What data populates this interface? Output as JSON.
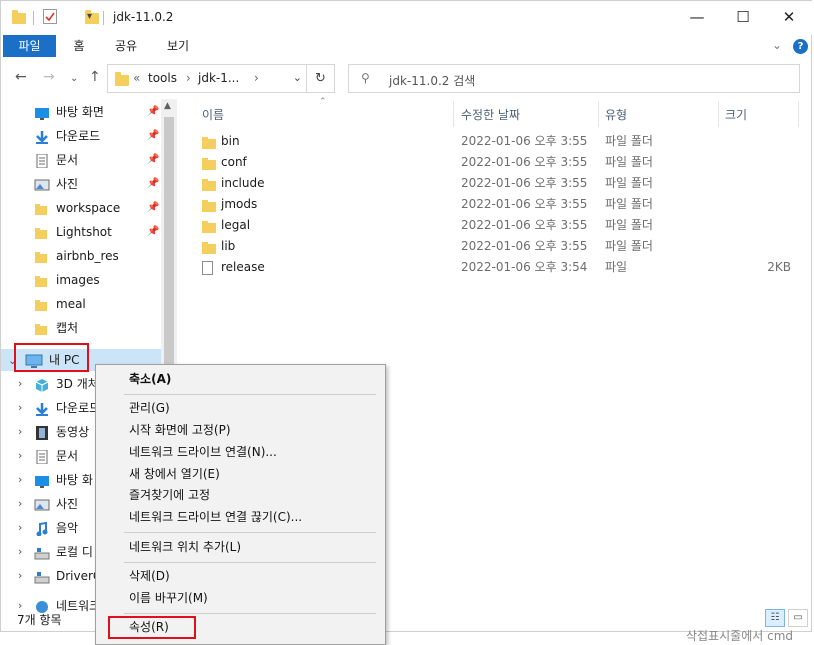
{
  "window": {
    "title": "jdk-11.0.2"
  },
  "ribbon": {
    "tabs": [
      "파일",
      "홈",
      "공유",
      "보기"
    ],
    "active_tab": "파일",
    "help": "?"
  },
  "address": {
    "crumbs": [
      "«",
      "tools",
      "›",
      "jdk-1...",
      "›"
    ],
    "dropdown": "⌄",
    "refresh": "↻"
  },
  "search": {
    "placeholder": "jdk-11.0.2 검색"
  },
  "nav_pane": {
    "quick_access": [
      {
        "label": "바탕 화면",
        "icon": "desktop-icon",
        "pinned": true
      },
      {
        "label": "다운로드",
        "icon": "download-icon",
        "pinned": true
      },
      {
        "label": "문서",
        "icon": "document-icon",
        "pinned": true
      },
      {
        "label": "사진",
        "icon": "picture-icon",
        "pinned": true
      },
      {
        "label": "workspace",
        "icon": "folder-icon",
        "pinned": true
      },
      {
        "label": "Lightshot",
        "icon": "folder-icon",
        "pinned": true
      },
      {
        "label": "airbnb_res",
        "icon": "folder-icon",
        "pinned": false
      },
      {
        "label": "images",
        "icon": "folder-icon",
        "pinned": false
      },
      {
        "label": "meal",
        "icon": "folder-icon",
        "pinned": false
      },
      {
        "label": "캡처",
        "icon": "folder-icon",
        "pinned": false
      }
    ],
    "this_pc": {
      "label": "내 PC",
      "icon": "computer-icon"
    },
    "this_pc_children": [
      {
        "label": "3D 개처",
        "icon": "cube-icon"
      },
      {
        "label": "다운로드",
        "icon": "download-icon"
      },
      {
        "label": "동영상",
        "icon": "film-icon"
      },
      {
        "label": "문서",
        "icon": "document-icon"
      },
      {
        "label": "바탕 화",
        "icon": "desktop-icon"
      },
      {
        "label": "사진",
        "icon": "picture-icon"
      },
      {
        "label": "음악",
        "icon": "music-icon"
      },
      {
        "label": "로컬 디",
        "icon": "drive-icon"
      },
      {
        "label": "DriverC",
        "icon": "drive-icon"
      },
      {
        "label": "네트워크",
        "icon": "network-icon"
      }
    ]
  },
  "columns": {
    "name": "이름",
    "modified": "수정한 날짜",
    "type": "유형",
    "size": "크기"
  },
  "files": [
    {
      "name": "bin",
      "modified": "2022-01-06 오후 3:55",
      "type": "파일 폴더",
      "size": "",
      "icon": "folder-icon"
    },
    {
      "name": "conf",
      "modified": "2022-01-06 오후 3:55",
      "type": "파일 폴더",
      "size": "",
      "icon": "folder-icon"
    },
    {
      "name": "include",
      "modified": "2022-01-06 오후 3:55",
      "type": "파일 폴더",
      "size": "",
      "icon": "folder-icon"
    },
    {
      "name": "jmods",
      "modified": "2022-01-06 오후 3:55",
      "type": "파일 폴더",
      "size": "",
      "icon": "folder-icon"
    },
    {
      "name": "legal",
      "modified": "2022-01-06 오후 3:55",
      "type": "파일 폴더",
      "size": "",
      "icon": "folder-icon"
    },
    {
      "name": "lib",
      "modified": "2022-01-06 오후 3:55",
      "type": "파일 폴더",
      "size": "",
      "icon": "folder-icon"
    },
    {
      "name": "release",
      "modified": "2022-01-06 오후 3:54",
      "type": "파일",
      "size": "2KB",
      "icon": "file-icon"
    }
  ],
  "status": {
    "item_count": "7개 항목",
    "background_text": "삭접표시줄에서 cmd"
  },
  "context_menu": {
    "items": [
      {
        "label": "축소(A)",
        "bold": true
      },
      {
        "label": "관리(G)"
      },
      {
        "label": "시작 화면에 고정(P)"
      },
      {
        "label": "네트워크 드라이브 연결(N)..."
      },
      {
        "label": "새 창에서 열기(E)"
      },
      {
        "label": "즐겨찾기에 고정"
      },
      {
        "label": "네트워크 드라이브 연결 끊기(C)..."
      },
      {
        "label": "네트워크 위치 추가(L)"
      },
      {
        "label": "삭제(D)"
      },
      {
        "label": "이름 바꾸기(M)"
      },
      {
        "label": "속성(R)"
      }
    ]
  },
  "colors": {
    "accent": "#1a6fc6",
    "highlight_box": "#e0101a",
    "selection": "#cce4f7",
    "folder": "#f5cf5e"
  }
}
